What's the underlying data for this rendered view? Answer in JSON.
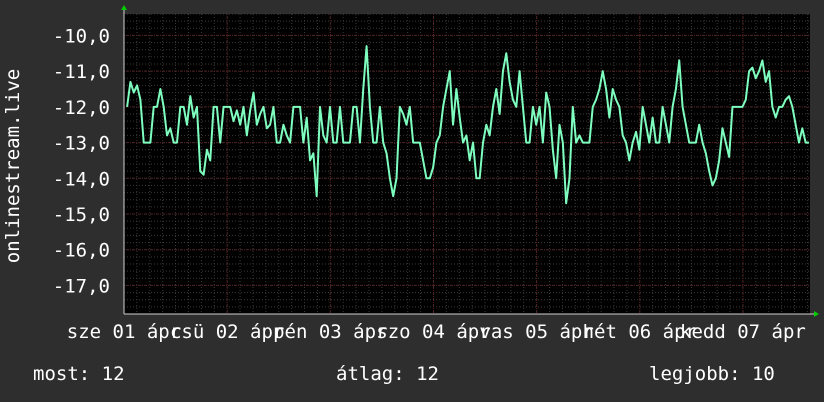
{
  "chart_data": {
    "type": "line",
    "ylabel": "onlinestream.live",
    "ylim": [
      -17.8,
      -9.4
    ],
    "y_ticks": [
      -10,
      -11,
      -12,
      -13,
      -14,
      -15,
      -16,
      -17
    ],
    "y_tick_labels": [
      "-10,0",
      "-11,0",
      "-12,0",
      "-13,0",
      "-14,0",
      "-15,0",
      "-16,0",
      "-17,0"
    ],
    "x_tick_labels": [
      "sze 01 ápr",
      "csü 02 ápr",
      "pén 03 ápr",
      "szo 04 ápr",
      "vas 05 ápr",
      "hét 06 ápr",
      "kedd 07 ápr"
    ],
    "x_tick_days": [
      1,
      2,
      3,
      4,
      5,
      6,
      7
    ],
    "xlim": [
      1,
      7.65
    ],
    "grid": true,
    "colors": {
      "line": "#7fffbf",
      "background": "#000000",
      "grid_major": "#5a1e1e",
      "grid_minor": "#3a3a3a",
      "axis_arrow": "#00cc00"
    },
    "series": [
      {
        "values": [
          -12.0,
          -11.3,
          -11.6,
          -11.4,
          -11.8,
          -13.0,
          -13.0,
          -13.0,
          -12.0,
          -12.0,
          -11.5,
          -12.0,
          -12.8,
          -12.6,
          -13.0,
          -13.0,
          -12.0,
          -12.0,
          -12.5,
          -11.7,
          -12.3,
          -12.0,
          -13.8,
          -13.9,
          -13.2,
          -13.5,
          -12.0,
          -12.0,
          -13.0,
          -12.0,
          -12.0,
          -12.0,
          -12.4,
          -12.1,
          -12.5,
          -12.0,
          -12.8,
          -12.1,
          -11.6,
          -12.5,
          -12.2,
          -12.0,
          -12.6,
          -12.5,
          -12.0,
          -13.0,
          -13.0,
          -12.5,
          -12.8,
          -13.0,
          -12.0,
          -12.0,
          -12.0,
          -13.0,
          -12.3,
          -13.5,
          -13.3,
          -14.5,
          -12.0,
          -12.8,
          -13.0,
          -12.0,
          -13.0,
          -13.0,
          -12.0,
          -13.0,
          -13.0,
          -13.0,
          -12.0,
          -12.0,
          -13.0,
          -11.5,
          -10.3,
          -12.0,
          -13.0,
          -13.0,
          -12.0,
          -13.0,
          -13.3,
          -14.0,
          -14.5,
          -14.0,
          -12.0,
          -12.2,
          -12.5,
          -12.0,
          -13.0,
          -13.0,
          -13.0,
          -13.5,
          -14.0,
          -14.0,
          -13.7,
          -13.0,
          -12.8,
          -12.0,
          -11.5,
          -11.0,
          -12.5,
          -11.5,
          -12.3,
          -13.0,
          -12.8,
          -13.5,
          -13.0,
          -14.0,
          -14.0,
          -13.0,
          -12.5,
          -12.8,
          -12.0,
          -11.5,
          -12.2,
          -11.0,
          -10.5,
          -11.3,
          -11.8,
          -12.0,
          -11.0,
          -12.0,
          -13.0,
          -13.0,
          -12.0,
          -12.5,
          -12.0,
          -13.0,
          -11.6,
          -12.0,
          -13.2,
          -14.0,
          -12.5,
          -13.0,
          -14.7,
          -14.0,
          -12.0,
          -13.0,
          -12.8,
          -13.0,
          -13.0,
          -13.0,
          -12.0,
          -11.8,
          -11.5,
          -11.0,
          -11.5,
          -12.3,
          -11.5,
          -11.8,
          -12.0,
          -12.8,
          -13.0,
          -13.5,
          -13.0,
          -12.7,
          -13.2,
          -12.0,
          -12.5,
          -13.0,
          -12.3,
          -13.0,
          -13.0,
          -12.0,
          -12.5,
          -13.0,
          -12.0,
          -11.5,
          -10.7,
          -12.0,
          -12.5,
          -13.0,
          -13.0,
          -13.0,
          -12.5,
          -13.0,
          -13.3,
          -13.8,
          -14.2,
          -14.0,
          -13.5,
          -12.6,
          -13.0,
          -13.4,
          -12.0,
          -12.0,
          -12.0,
          -12.0,
          -11.8,
          -11.0,
          -10.9,
          -11.2,
          -11.0,
          -10.7,
          -11.3,
          -11.0,
          -12.0,
          -12.3,
          -12.0,
          -12.0,
          -11.8,
          -11.7,
          -12.0,
          -12.5,
          -13.0,
          -12.6,
          -13.0,
          -13.0
        ]
      }
    ]
  },
  "stats": {
    "now": "most: 12",
    "avg": "átlag: 12",
    "best": "legjobb: 10"
  }
}
